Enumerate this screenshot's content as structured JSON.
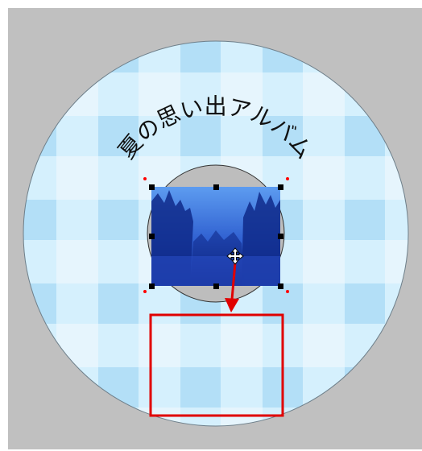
{
  "label": {
    "arc_text": "夏の思い出アルバム"
  },
  "colors": {
    "canvas_background": "#c0c0c0",
    "disc_base": "#e6f5fd",
    "disc_band": "#cfeefc",
    "disc_square": "#a6d9f4",
    "disc_outline": "#6e7f8a",
    "hub": "#bdbdbd",
    "selection_handle": "#000000",
    "rotate_handle": "#ff0000",
    "move_arrow": "#e00000",
    "drop_target_outline": "#e00000",
    "photo_sky": "#4d86e0",
    "photo_trees": "#0f2a8a"
  },
  "icons": {
    "move_cursor": "move-cross-icon",
    "move_arrow": "arrow-down-icon"
  }
}
